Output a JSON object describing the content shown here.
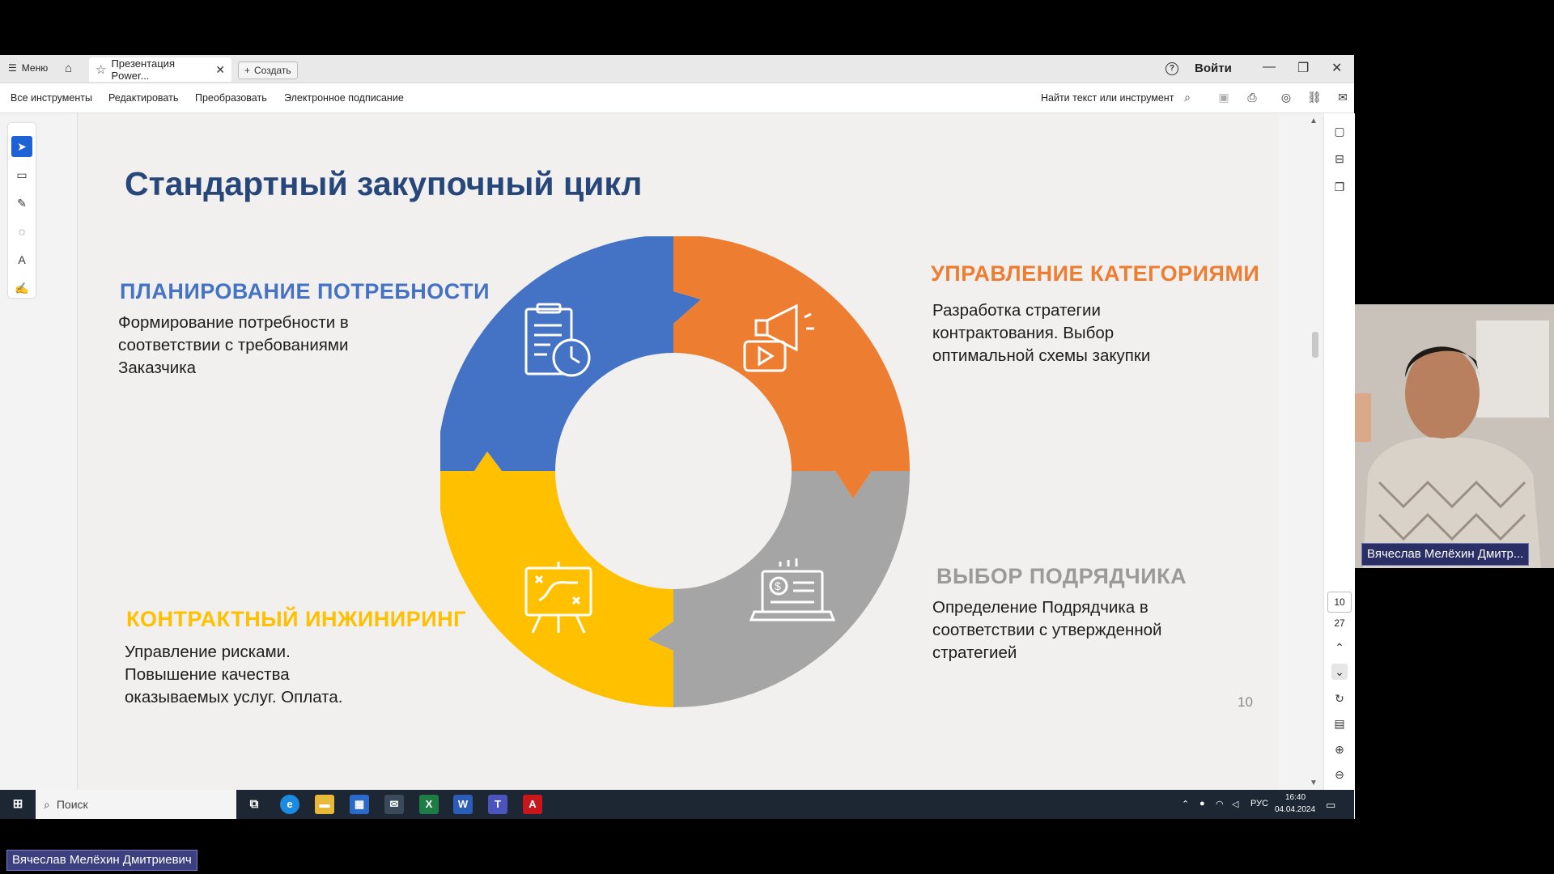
{
  "titlebar": {
    "menu_label": "Меню",
    "tab_title": "Презентация Power...",
    "create_label": "Создать",
    "login_label": "Войти"
  },
  "toolbar": {
    "items": [
      "Все инструменты",
      "Редактировать",
      "Преобразовать",
      "Электронное подписание"
    ],
    "search_label": "Найти текст или инструмент"
  },
  "slide": {
    "title": "Стандартный закупочный цикл",
    "page_number": "10",
    "sections": [
      {
        "heading": "ПЛАНИРОВАНИЕ ПОТРЕБНОСТИ",
        "text": "Формирование потребности в\nсоответствии с требованиями\nЗаказчика",
        "color": "#4472c4"
      },
      {
        "heading": "УПРАВЛЕНИЕ КАТЕГОРИЯМИ",
        "text": "Разработка стратегии\nконтрактования.  Выбор\nоптимальной схемы закупки",
        "color": "#ed7d31"
      },
      {
        "heading": "ВЫБОР ПОДРЯДЧИКА",
        "text": "Определение Подрядчика в\nсоответствии с утвержденной\nстратегией",
        "color": "#9a9a9a"
      },
      {
        "heading": "КОНТРАКТНЫЙ ИНЖИНИРИНГ",
        "text": "Управление рисками.\nПовышение качества\nоказываемых услуг. Оплата.",
        "color": "#ffc000"
      }
    ],
    "ring_colors": {
      "blue": "#4472c4",
      "orange": "#ed7d31",
      "gray": "#a5a5a5",
      "yellow": "#ffc000"
    }
  },
  "pager": {
    "current": "10",
    "total": "27"
  },
  "taskbar": {
    "search_placeholder": "Поиск",
    "lang": "РУС",
    "time": "16:40",
    "date": "04.04.2024"
  },
  "webcam": {
    "participant_name": "Вячеслав Мелёхин Дмитр..."
  },
  "bottom_label": "Вячеслав Мелёхин Дмитриевич"
}
